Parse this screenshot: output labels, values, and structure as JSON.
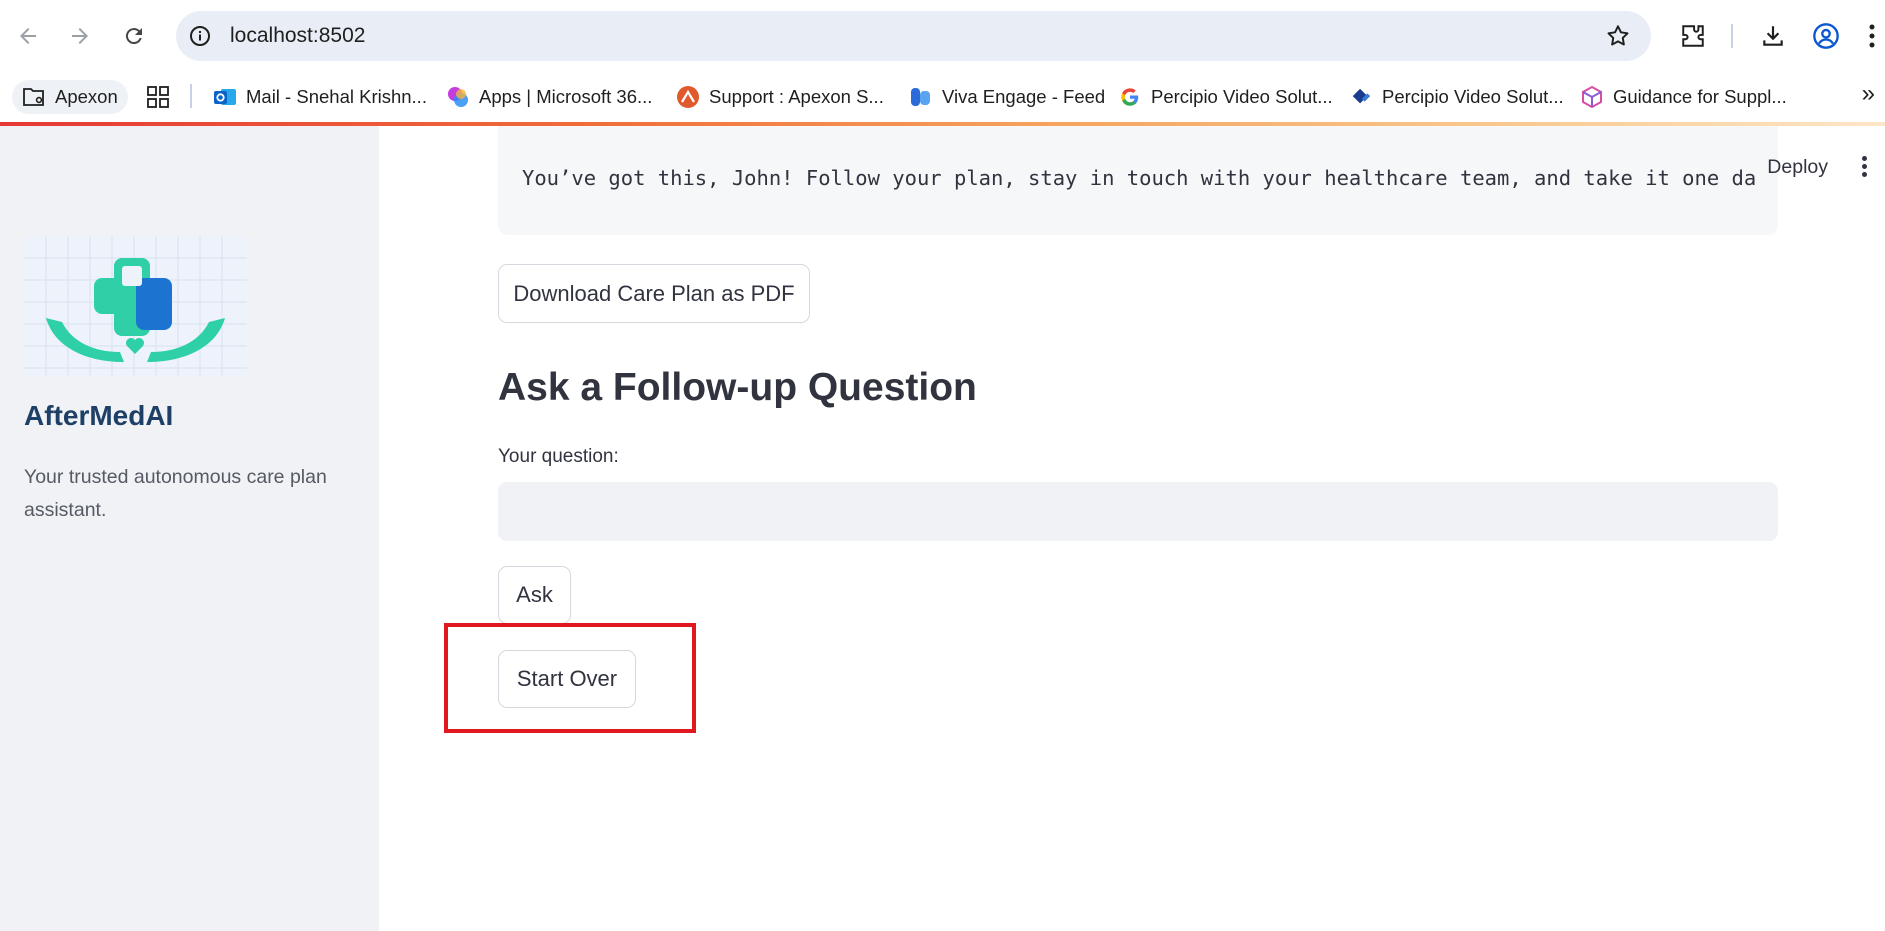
{
  "browser": {
    "url": "localhost:8502",
    "bookmarks": [
      {
        "label": "Apexon",
        "icon": "folder-settings-icon"
      },
      {
        "label": "Mail - Snehal Krishn...",
        "icon": "outlook-icon"
      },
      {
        "label": "Apps | Microsoft 36...",
        "icon": "microsoft365-icon"
      },
      {
        "label": "Support : Apexon S...",
        "icon": "support-icon"
      },
      {
        "label": "Viva Engage - Feed",
        "icon": "viva-engage-icon"
      },
      {
        "label": "Percipio Video Solut...",
        "icon": "google-icon"
      },
      {
        "label": "Percipio Video Solut...",
        "icon": "percipio-icon"
      },
      {
        "label": "Guidance for Suppl...",
        "icon": "cube-icon"
      }
    ]
  },
  "sidebar": {
    "brand": "AfterMedAI",
    "tagline": "Your trusted autonomous care plan assistant."
  },
  "header": {
    "deploy_label": "Deploy"
  },
  "main": {
    "care_plan_partial": "                                                                            ",
    "care_plan_last_line": "You’ve got this, John! Follow your plan, stay in touch with your healthcare team, and take it one da",
    "download_button": "Download Care Plan as PDF",
    "followup_heading": "Ask a Follow-up Question",
    "question_label": "Your question:",
    "question_value": "",
    "ask_button": "Ask",
    "start_over_button": "Start Over"
  },
  "colors": {
    "annotation_box": "#e0181f",
    "brand": "#1e3f66",
    "sidebar_bg": "#f0f2f6"
  }
}
